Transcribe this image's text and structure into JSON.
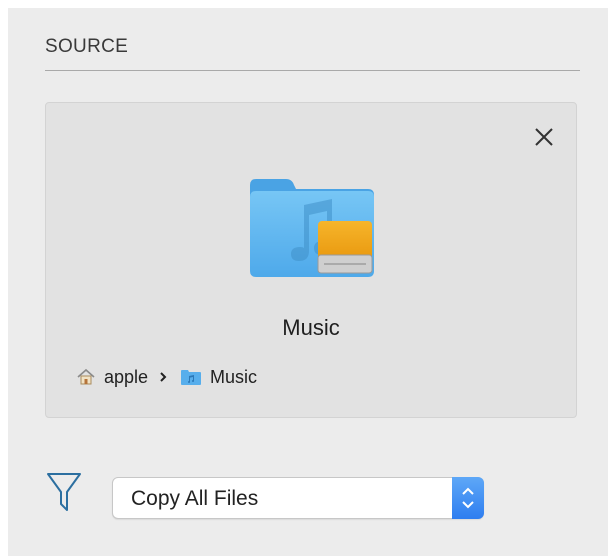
{
  "source": {
    "header": "SOURCE",
    "close_icon": "close-icon",
    "folder": {
      "name": "Music",
      "icon": "music-folder-with-drive-icon",
      "accent": "#5cb6ef",
      "drive_color": "#f2a313"
    },
    "path": [
      {
        "label": "apple",
        "icon": "home-icon"
      },
      {
        "label": "Music",
        "icon": "music-folder-icon"
      }
    ],
    "path_separator_icon": "chevron-right-icon"
  },
  "filter": {
    "icon": "filter-funnel-icon",
    "selected": "Copy All Files",
    "stepper_icon": "up-down-chevron-icon",
    "accent": "#2e7ef0"
  }
}
